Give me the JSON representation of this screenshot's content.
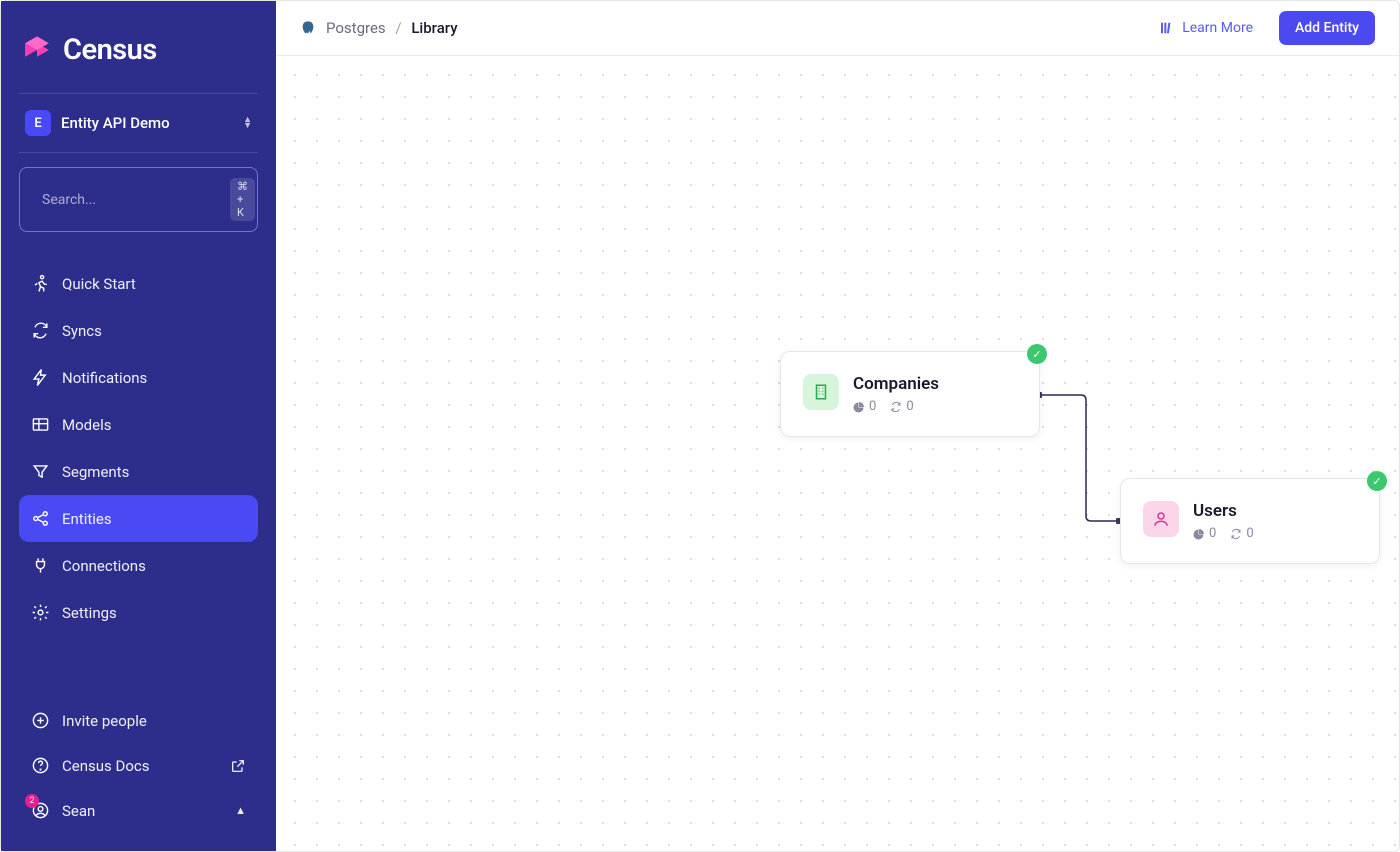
{
  "brand": "Census",
  "org": {
    "badge": "E",
    "name": "Entity API Demo"
  },
  "search": {
    "placeholder": "Search...",
    "shortcut": "⌘ + K"
  },
  "nav": {
    "quickstart": "Quick Start",
    "syncs": "Syncs",
    "notifications": "Notifications",
    "models": "Models",
    "segments": "Segments",
    "entities": "Entities",
    "connections": "Connections",
    "settings": "Settings"
  },
  "footer": {
    "invite": "Invite people",
    "docs": "Census Docs",
    "user": "Sean",
    "badge": "2"
  },
  "breadcrumb": {
    "source": "Postgres",
    "page": "Library"
  },
  "topbar": {
    "learn": "Learn More",
    "add": "Add Entity"
  },
  "nodes": {
    "companies": {
      "title": "Companies",
      "segments": "0",
      "syncs": "0"
    },
    "users": {
      "title": "Users",
      "segments": "0",
      "syncs": "0"
    }
  }
}
